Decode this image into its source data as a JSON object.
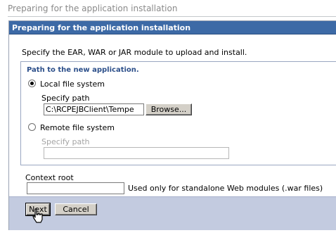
{
  "page_title": "Preparing for the application installation",
  "panel": {
    "header": "Preparing for the application installation",
    "instructions": "Specify the EAR, WAR or JAR module to upload and install."
  },
  "path_group": {
    "legend": "Path to the new application.",
    "local": {
      "label": "Local file system",
      "checked": true,
      "specify_label": "Specify path",
      "path_value": "C:\\RCPEJBClient\\Tempe",
      "browse_label": "Browse..."
    },
    "remote": {
      "label": "Remote file system",
      "checked": false,
      "specify_label": "Specify path",
      "path_value": ""
    }
  },
  "context_root": {
    "label": "Context root",
    "value": "",
    "hint": "Used only for standalone Web modules (.war files)"
  },
  "buttons": {
    "next": "Next",
    "cancel": "Cancel"
  },
  "colors": {
    "header_bg": "#3d6aa6",
    "footer_bg": "#c3cbe0",
    "legend_text": "#2c4f8a"
  },
  "icons": {
    "cursor": "hand-pointer-icon"
  }
}
